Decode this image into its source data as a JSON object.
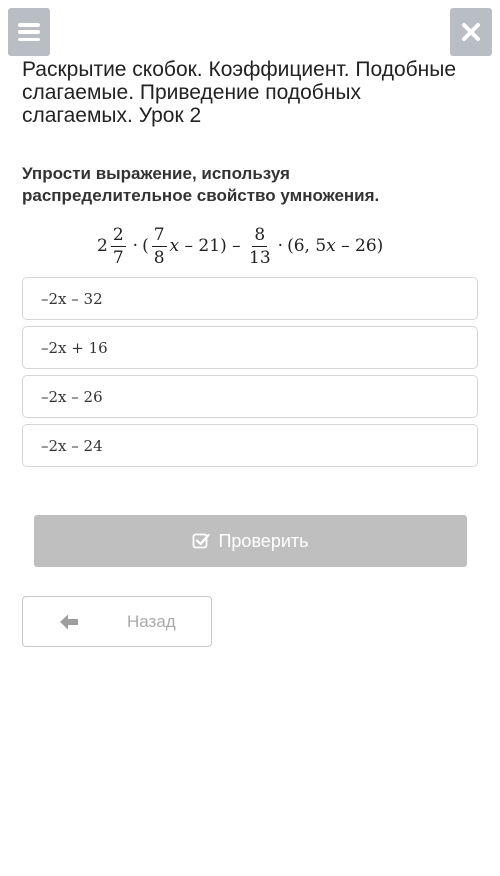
{
  "header": {
    "menu_icon": "hamburger-menu-icon",
    "close_icon": "close-x-icon",
    "lesson_title": "Раскрытие скобок. Коэффициент. Подобные слагаемые. Приведение подобных слагаемых. Урок 2"
  },
  "task": {
    "prompt": "Упрости выражение, используя распределительное свойство умножения.",
    "expression": {
      "whole": "2",
      "frac1_num": "2",
      "frac1_den": "7",
      "dot1": "·",
      "open1": "(",
      "frac2_num": "7",
      "frac2_den": "8",
      "var1": "x",
      "minus21": " – 21)",
      "minus": " – ",
      "frac3_num": "8",
      "frac3_den": "13",
      "dot2": "·",
      "paren2_start": "(6, 5",
      "var2": "x",
      "paren2_end": " – 26)"
    }
  },
  "options": [
    {
      "label": "–2x – 32"
    },
    {
      "label": "–2x + 16"
    },
    {
      "label": "–2x – 26"
    },
    {
      "label": "–2x – 24"
    }
  ],
  "actions": {
    "check_label": "Проверить",
    "check_icon": "checkbox-check-icon",
    "back_label": "Назад",
    "back_icon": "arrow-left-icon"
  },
  "colors": {
    "icon_button_bg": "#b9bec4",
    "check_button_disabled": "#bfbfbf",
    "option_border": "#d6d6d6"
  }
}
